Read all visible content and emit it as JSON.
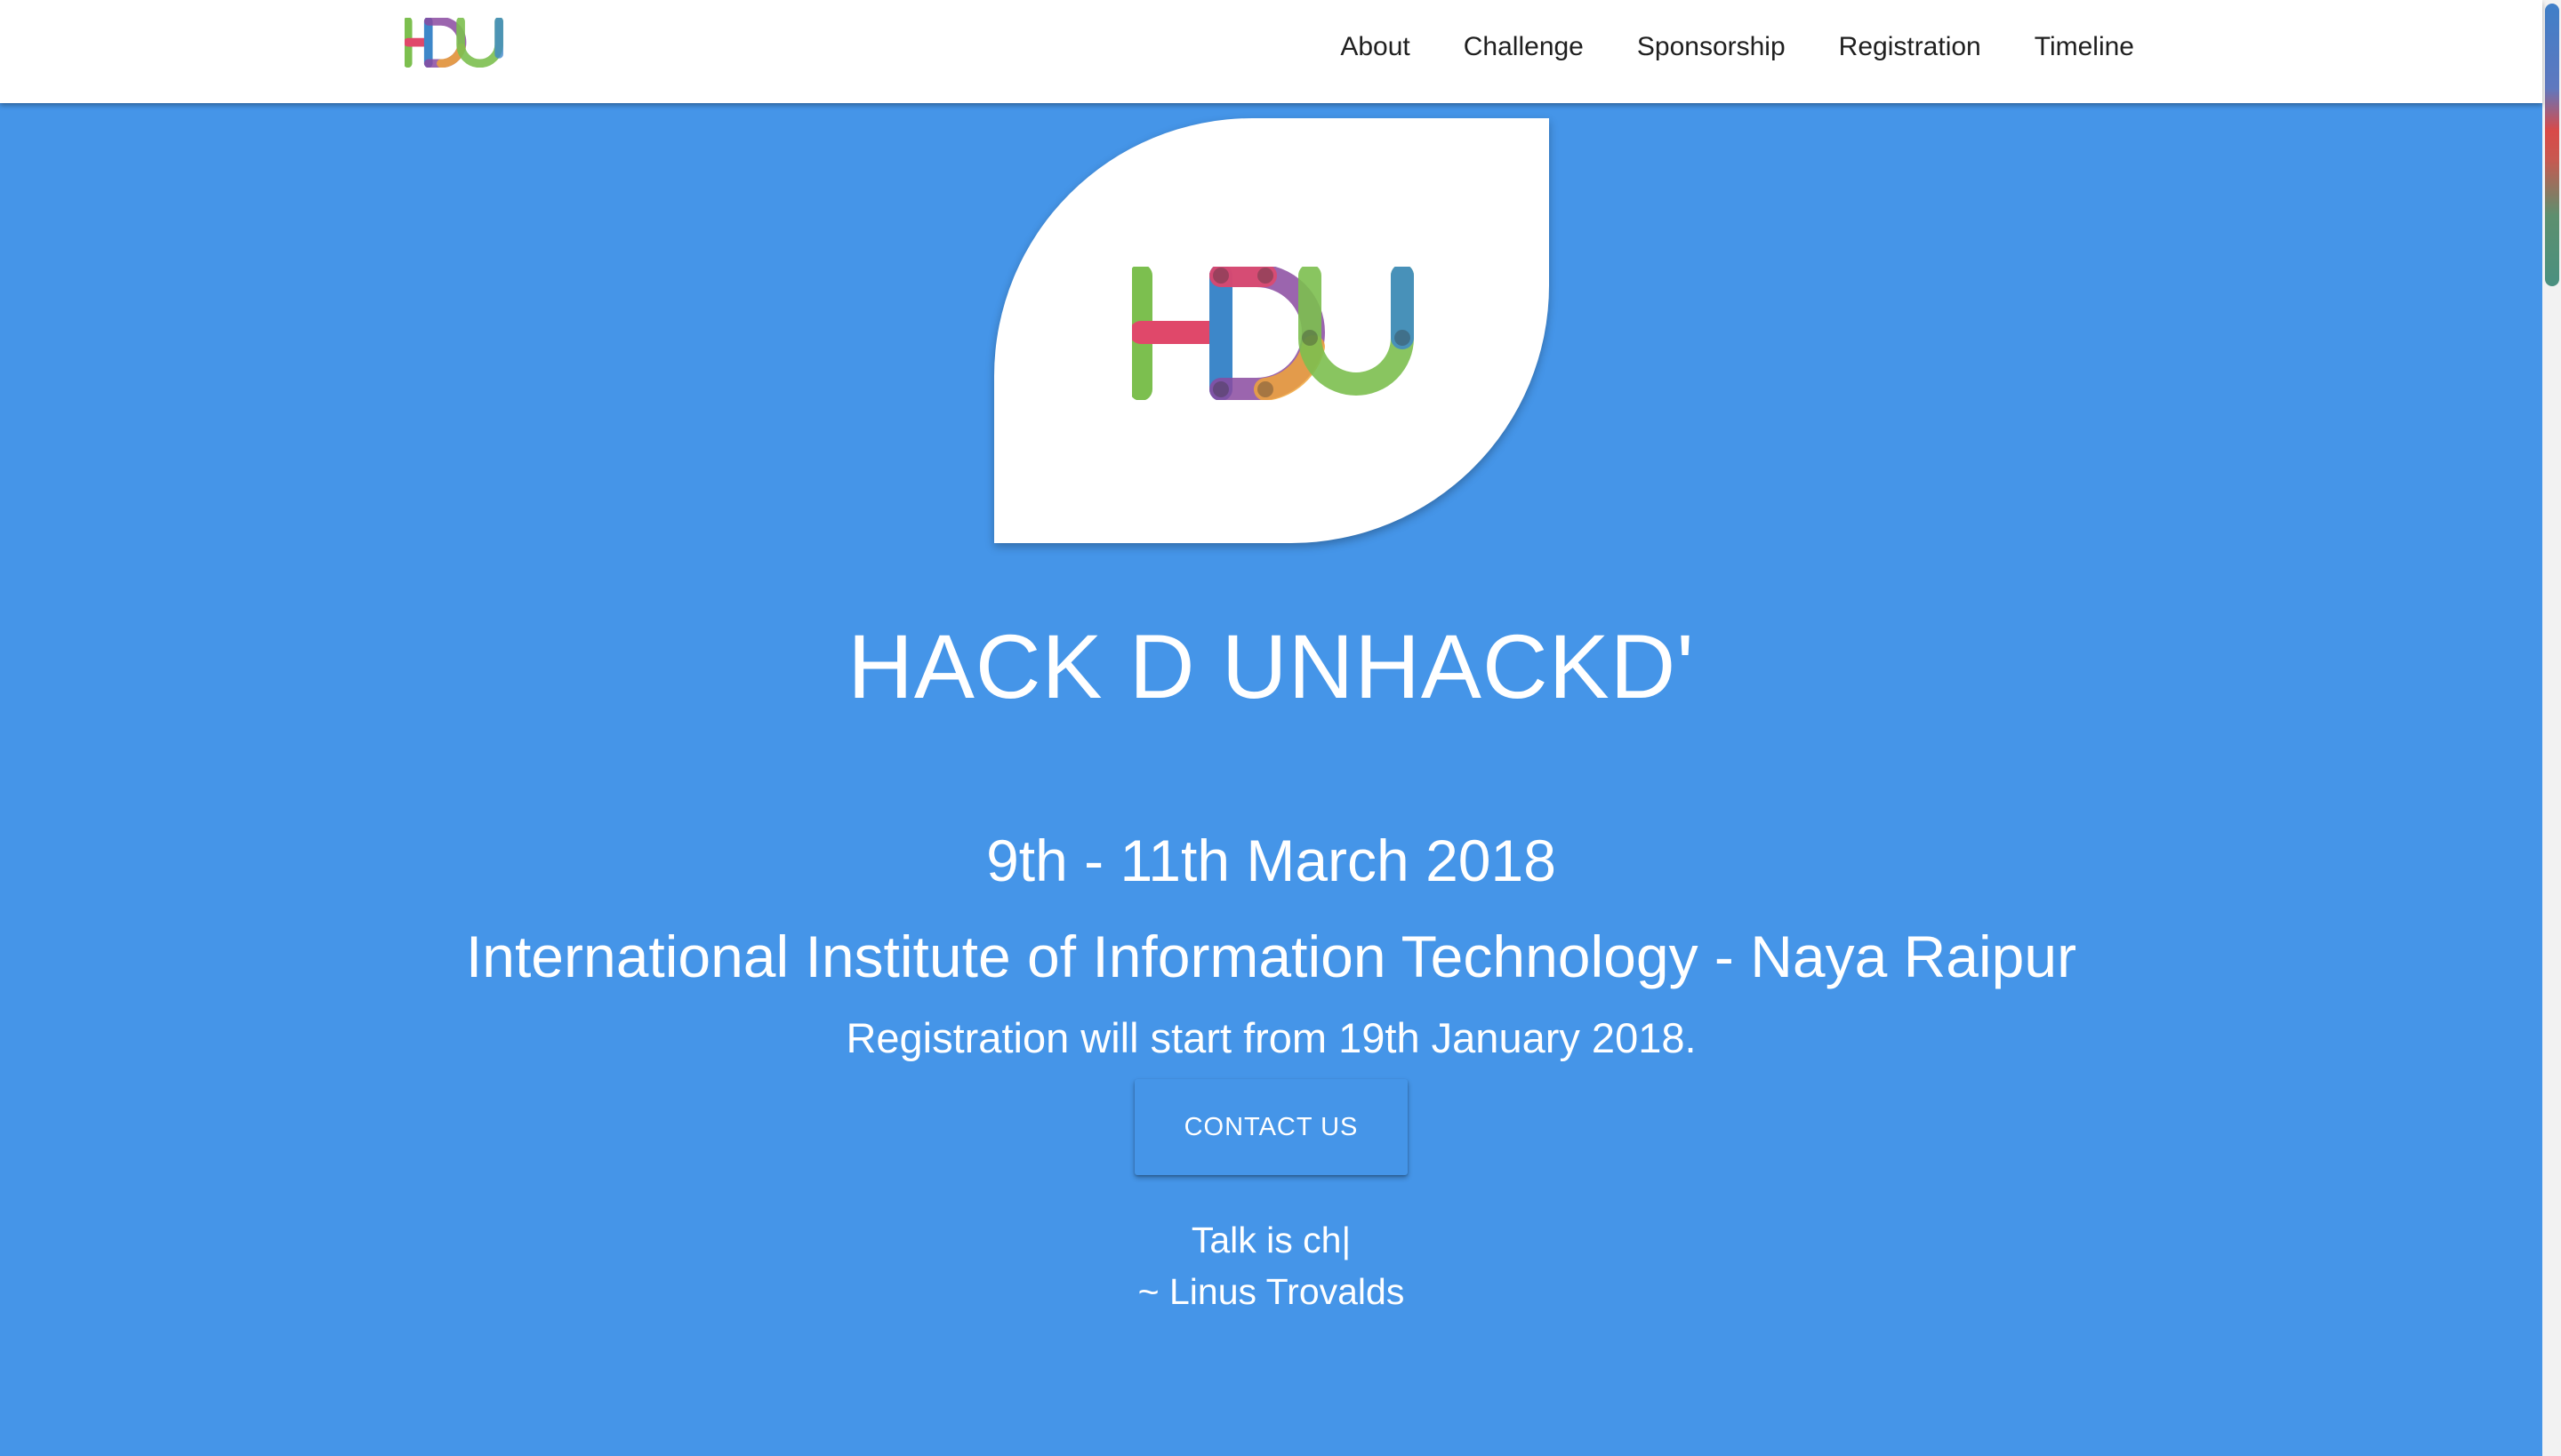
{
  "nav": {
    "logo_text": "HDU",
    "links": [
      "About",
      "Challenge",
      "Sponsorship",
      "Registration",
      "Timeline"
    ]
  },
  "hero": {
    "logo_text": "HDU",
    "title": "HACK D UNHACKD'",
    "dates": "9th - 11th March 2018",
    "venue": "International Institute of Information Technology - Naya Raipur",
    "registration": "Registration will start from 19th January 2018.",
    "contact_button": "CONTACT US",
    "quote": "Talk is ch|",
    "quote_author": "~ Linus Trovalds"
  },
  "colors": {
    "hero_background": "#4595e8",
    "nav_background": "#ffffff",
    "logo_green": "#7cbf4f",
    "logo_red": "#e0486a",
    "logo_blue": "#3d87c9",
    "logo_purple": "#8a4aa0",
    "logo_orange": "#f0a43a"
  }
}
